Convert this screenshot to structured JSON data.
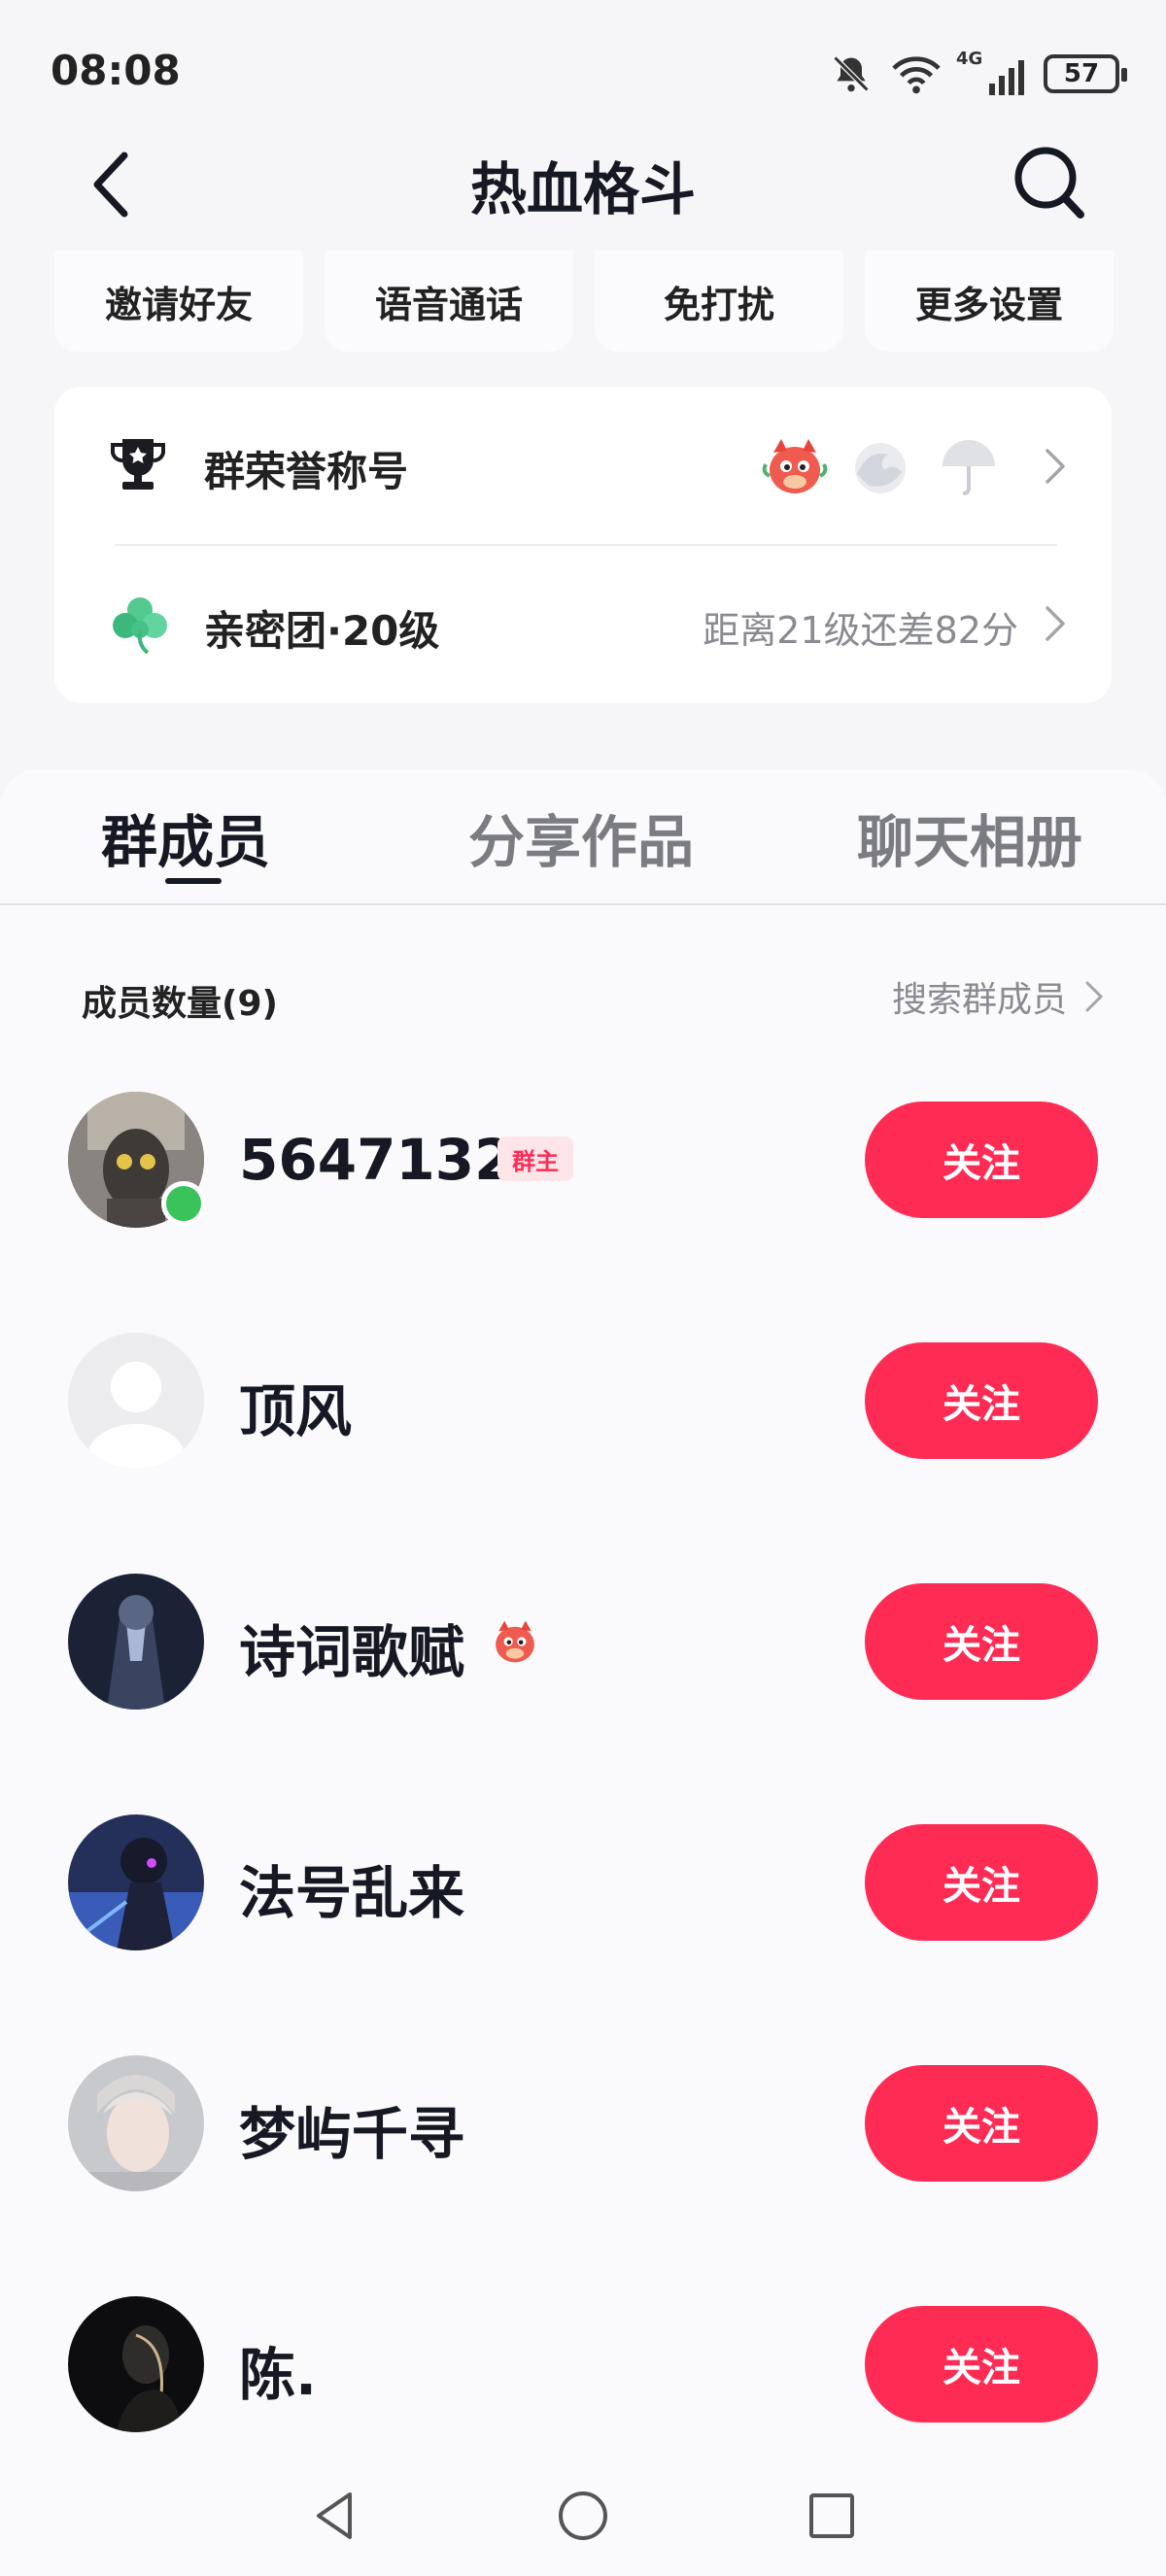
{
  "status_bar": {
    "time": "08:08",
    "network_label": "4G",
    "battery": "57",
    "icons": [
      "mute-bell-icon",
      "wifi-icon",
      "signal-icon",
      "battery-icon"
    ]
  },
  "header": {
    "title": "热血格斗",
    "back_icon": "back-arrow-icon",
    "search_icon": "search-icon"
  },
  "quick_actions": [
    {
      "label": "邀请好友"
    },
    {
      "label": "语音通话"
    },
    {
      "label": "免打扰"
    },
    {
      "label": "更多设置"
    }
  ],
  "honor_row": {
    "label": "群荣誉称号",
    "icon": "trophy-icon",
    "badges": [
      "dragon-badge-icon",
      "wave-badge-icon",
      "umbrella-badge-icon"
    ]
  },
  "intimacy_row": {
    "label": "亲密团·20级",
    "icon": "clover-icon",
    "hint": "距离21级还差82分"
  },
  "tabs": [
    {
      "label": "群成员",
      "active": true
    },
    {
      "label": "分享作品",
      "active": false
    },
    {
      "label": "聊天相册",
      "active": false
    }
  ],
  "members_section": {
    "count_label": "成员数量(9)",
    "search_label": "搜索群成员"
  },
  "members": [
    {
      "name": "5647132",
      "badge": "群主",
      "online": true,
      "follow_label": "关注"
    },
    {
      "name": "顶风",
      "follow_label": "关注"
    },
    {
      "name": "诗词歌赋",
      "follow_label": "关注"
    },
    {
      "name": "法号乱来",
      "follow_label": "关注"
    },
    {
      "name": "梦屿千寻",
      "follow_label": "关注"
    },
    {
      "name": "陈.",
      "follow_label": "关注"
    }
  ],
  "colors": {
    "accent": "#fe2c55",
    "online": "#3ac35a",
    "background": "#f6f6f8"
  },
  "nav_bar": [
    "back-triangle-icon",
    "home-circle-icon",
    "recents-square-icon"
  ]
}
